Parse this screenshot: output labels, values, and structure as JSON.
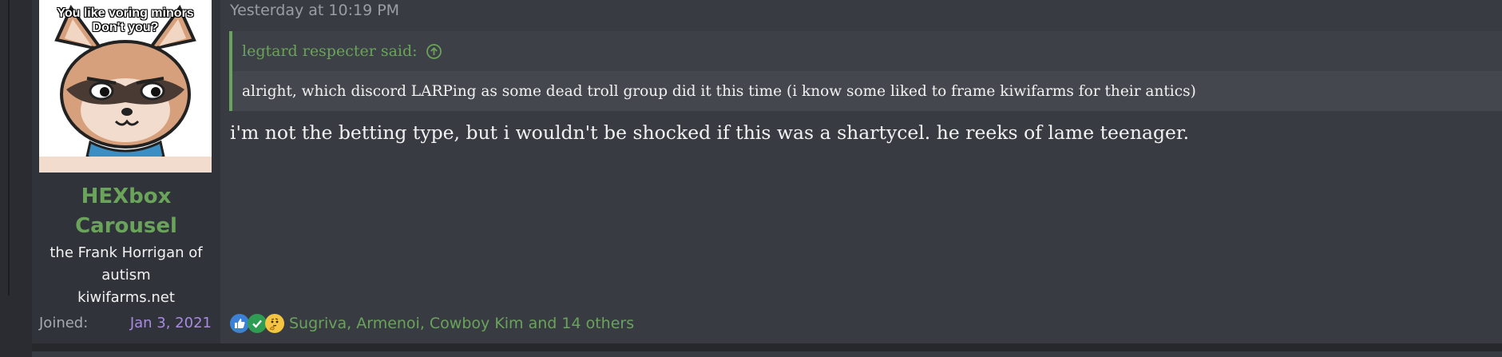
{
  "post": {
    "timestamp": "Yesterday at 10:19 PM",
    "avatar": {
      "caption_line1": "You like voring minors",
      "caption_line2": "Don't you?",
      "icon": "raccoon-avatar"
    },
    "user": {
      "name_line1": "HEXbox",
      "name_line2": "Carousel",
      "title": "the Frank Horrigan of autism",
      "site": "kiwifarms.net",
      "joined_label": "Joined:",
      "joined_date": "Jan 3, 2021"
    },
    "quote": {
      "author": "legtard respecter said:",
      "arrow_icon": "arrow-up-circle-icon",
      "text": "alright, which discord LARPing as some dead troll group did it this time (i know some liked to frame kiwifarms for their antics)"
    },
    "message": "i'm not the betting type, but i wouldn't be shocked if this was a shartycel. he reeks of lame teenager.",
    "reactions": {
      "icons": [
        "thumbs-up-icon",
        "checkmark-icon",
        "thinking-face-icon"
      ],
      "users_text": "Sugriva, Armenoi, Cowboy Kim and 14 others"
    }
  },
  "colors": {
    "accent_green": "#6aa35a",
    "joined_purple": "#a98be0",
    "post_bg": "#383b42",
    "user_col_bg": "#30333a"
  }
}
